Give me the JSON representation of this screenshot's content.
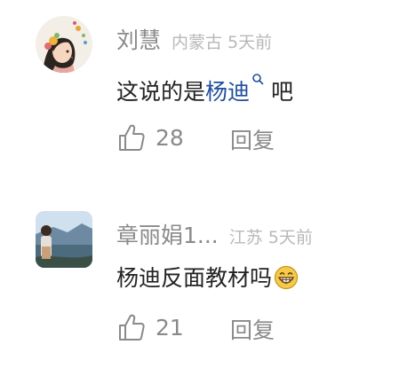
{
  "comments": [
    {
      "name": "刘慧",
      "location": "内蒙古",
      "time": "5天前",
      "text_link": "杨迪",
      "text_after": "吧",
      "text_before": "这说的是",
      "likes": "28",
      "reply_label": "回复",
      "avatar_icon": "cartoon-girl-avatar"
    },
    {
      "name": "章丽娟1...",
      "location": "江苏",
      "time": "5天前",
      "text": "杨迪反面教材吗",
      "emoji": "grinning-face-emoji",
      "likes": "21",
      "reply_label": "回复",
      "avatar_icon": "photo-avatar"
    }
  ],
  "colors": {
    "name": "#8a8a8a",
    "meta": "#b8b8b8",
    "text": "#222222",
    "link": "#1f4e9c"
  }
}
